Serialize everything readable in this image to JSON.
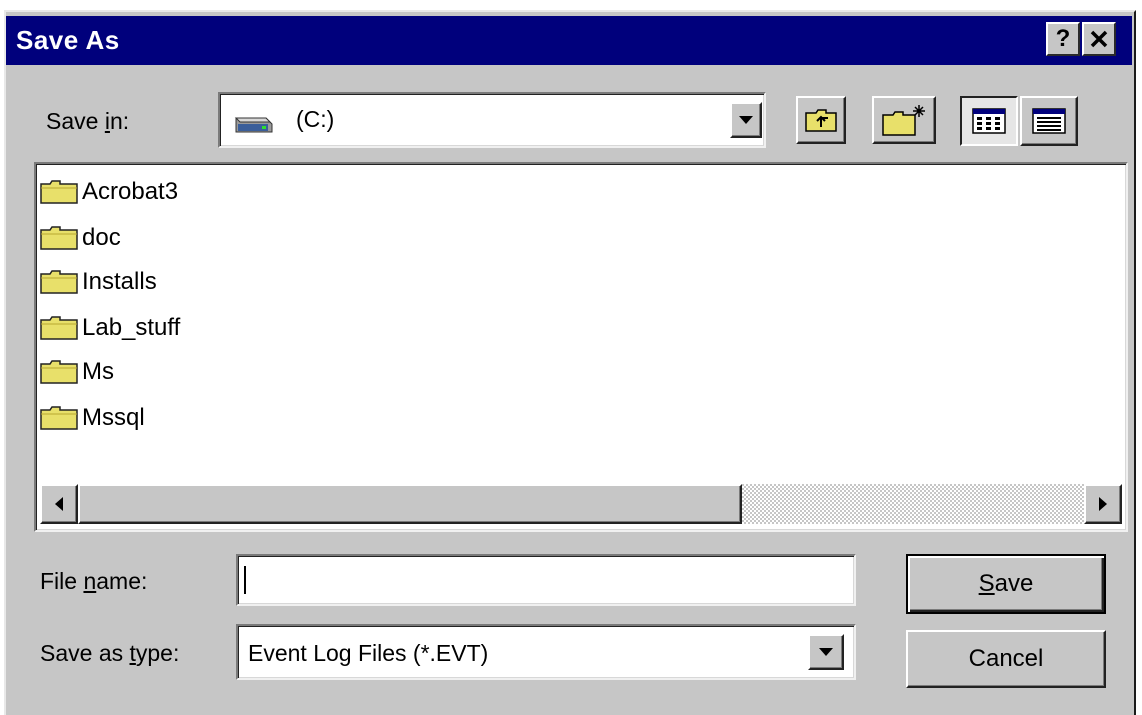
{
  "dialog": {
    "title": "Save As",
    "help_button": "?",
    "close_button": "✕"
  },
  "save_in": {
    "label_prefix": "Save ",
    "label_accel": "i",
    "label_suffix": "n:",
    "value": "(C:)",
    "drive_icon": "hard-drive-icon"
  },
  "toolbar": {
    "up_one_level_icon": "up-folder-icon",
    "new_folder_icon": "new-folder-icon",
    "list_view_icon": "list-view-icon",
    "details_view_icon": "details-view-icon"
  },
  "files": [
    {
      "name": "Acrobat3"
    },
    {
      "name": "doc"
    },
    {
      "name": "Installs"
    },
    {
      "name": "Lab_stuff"
    },
    {
      "name": "Ms"
    },
    {
      "name": "Mssql"
    }
  ],
  "file_name": {
    "label_prefix": "File ",
    "label_accel": "n",
    "label_suffix": "ame:",
    "value": ""
  },
  "save_as_type": {
    "label_prefix": "Save as ",
    "label_accel": "t",
    "label_suffix": "ype:",
    "value": "Event Log Files (*.EVT)"
  },
  "buttons": {
    "save_accel": "S",
    "save_rest": "ave",
    "cancel": "Cancel"
  },
  "colors": {
    "titlebar": "#00007c",
    "face": "#c6c6c6",
    "folder": "#e8e06a"
  }
}
